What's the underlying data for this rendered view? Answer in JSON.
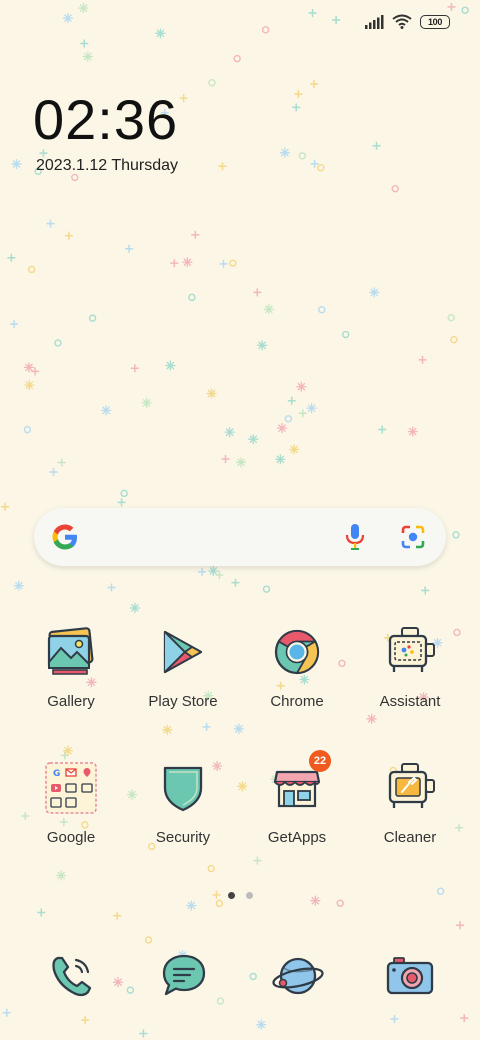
{
  "status_bar": {
    "battery": "100",
    "icons": [
      "signal-icon",
      "wifi-icon",
      "battery-icon"
    ]
  },
  "clock": {
    "time": "02:36",
    "date": "2023.1.12 Thursday"
  },
  "search_bar": {
    "icons": [
      "google-g-icon",
      "microphone-icon",
      "google-lens-icon"
    ]
  },
  "apps": [
    {
      "label": "Gallery",
      "icon": "gallery-icon"
    },
    {
      "label": "Play Store",
      "icon": "play-store-icon"
    },
    {
      "label": "Chrome",
      "icon": "chrome-icon"
    },
    {
      "label": "Assistant",
      "icon": "assistant-icon"
    },
    {
      "label": "Google",
      "icon": "google-folder-icon"
    },
    {
      "label": "Security",
      "icon": "security-shield-icon"
    },
    {
      "label": "GetApps",
      "icon": "getapps-store-icon",
      "badge": "22"
    },
    {
      "label": "Cleaner",
      "icon": "cleaner-icon"
    }
  ],
  "page_indicator": {
    "pages": 2,
    "current": 1
  },
  "dock": [
    {
      "icon": "phone-icon"
    },
    {
      "icon": "messages-icon"
    },
    {
      "icon": "browser-planet-icon"
    },
    {
      "icon": "camera-icon"
    }
  ],
  "colors": {
    "background": "#fbf6e6",
    "accent_teal": "#6cc7b0",
    "badge": "#f05a1e",
    "outline": "#2f3b47"
  }
}
